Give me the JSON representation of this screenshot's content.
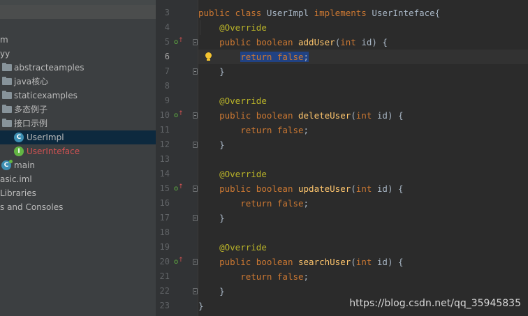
{
  "sidebar": {
    "items": [
      {
        "label": "m",
        "icon": "none",
        "indent": 0,
        "color": "normal"
      },
      {
        "label": "yy",
        "icon": "none",
        "indent": 0,
        "color": "normal"
      },
      {
        "label": "abstracteamples",
        "icon": "folder-icon",
        "color": "normal"
      },
      {
        "label": "java核心",
        "icon": "folder-icon",
        "color": "normal"
      },
      {
        "label": "staticexamples",
        "icon": "folder-icon",
        "color": "normal"
      },
      {
        "label": "多态例子",
        "icon": "folder-icon",
        "color": "normal"
      },
      {
        "label": "接口示例",
        "icon": "folder-icon",
        "color": "normal"
      },
      {
        "label": "UserImpl",
        "icon": "class-icon",
        "badge": "C",
        "color": "normal",
        "selected": true
      },
      {
        "label": "UserInteface",
        "icon": "interface-icon",
        "badge": "I",
        "color": "red"
      },
      {
        "label": "main",
        "icon": "main-class-icon",
        "badge": "C",
        "color": "normal"
      },
      {
        "label": "asic.iml",
        "icon": "none",
        "color": "normal"
      },
      {
        "label": "Libraries",
        "icon": "none",
        "color": "normal"
      },
      {
        "label": "s and Consoles",
        "icon": "none",
        "color": "normal"
      }
    ]
  },
  "editor": {
    "lines": [
      {
        "n": "3",
        "text": "public class UserImpl implements UserInteface{"
      },
      {
        "n": "4",
        "text": "    @Override"
      },
      {
        "n": "5",
        "text": "    public boolean addUser(int id) {"
      },
      {
        "n": "6",
        "text": "        return false;"
      },
      {
        "n": "7",
        "text": "    }"
      },
      {
        "n": "8",
        "text": ""
      },
      {
        "n": "9",
        "text": "    @Override"
      },
      {
        "n": "10",
        "text": "    public boolean deleteUser(int id) {"
      },
      {
        "n": "11",
        "text": "        return false;"
      },
      {
        "n": "12",
        "text": "    }"
      },
      {
        "n": "13",
        "text": ""
      },
      {
        "n": "14",
        "text": "    @Override"
      },
      {
        "n": "15",
        "text": "    public boolean updateUser(int id) {"
      },
      {
        "n": "16",
        "text": "        return false;"
      },
      {
        "n": "17",
        "text": "    }"
      },
      {
        "n": "18",
        "text": ""
      },
      {
        "n": "19",
        "text": "    @Override"
      },
      {
        "n": "20",
        "text": "    public boolean searchUser(int id) {"
      },
      {
        "n": "21",
        "text": "        return false;"
      },
      {
        "n": "22",
        "text": "    }"
      },
      {
        "n": "23",
        "text": "}"
      }
    ],
    "current_line": "6",
    "selected_text": "return false;",
    "override_marker_lines": [
      "5",
      "10",
      "15",
      "20"
    ]
  },
  "watermark": "https://blog.csdn.net/qq_35945835",
  "colors": {
    "keyword": "#cc7832",
    "annotation": "#bbb529",
    "method": "#ffc66d",
    "plain": "#a9b7c6",
    "selection": "#214283",
    "sidebar_bg": "#3c3f41",
    "editor_bg": "#2b2b2b",
    "error_red": "#d25252"
  }
}
